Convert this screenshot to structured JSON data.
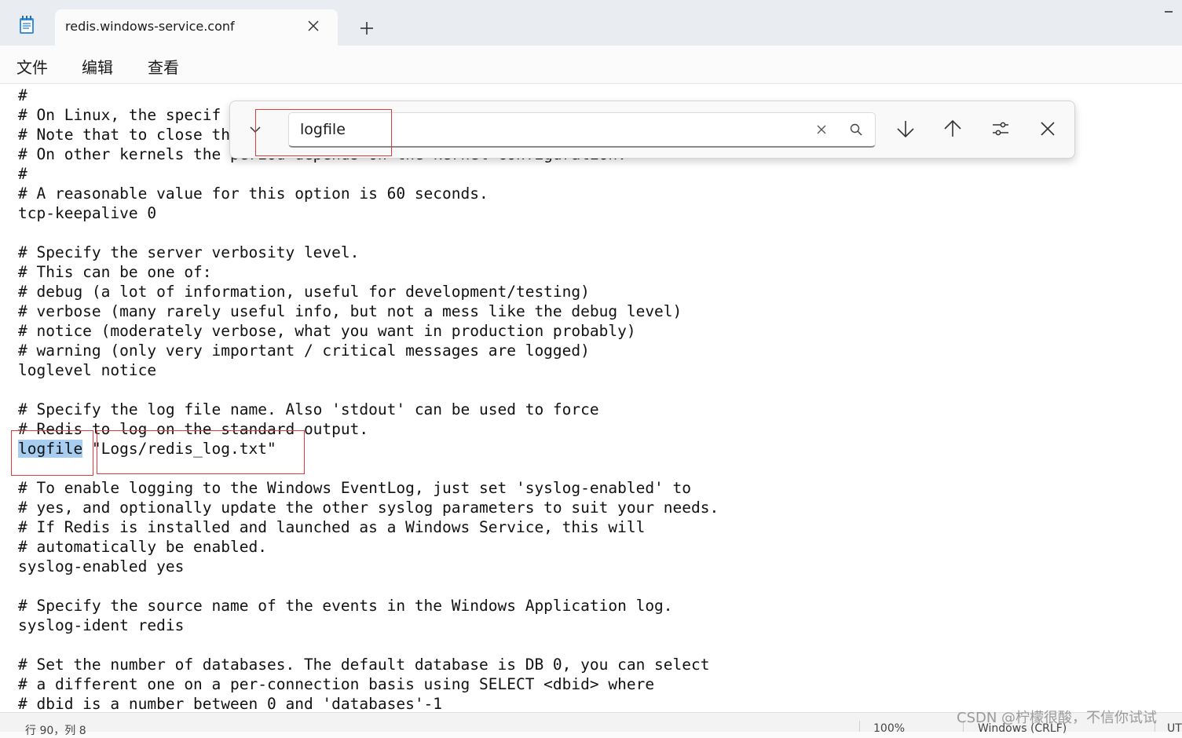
{
  "window": {
    "tab_title": "redis.windows-service.conf",
    "new_tab_label": "+"
  },
  "menu": {
    "items": [
      "文件",
      "编辑",
      "查看"
    ]
  },
  "find": {
    "query": "logfile"
  },
  "editor": {
    "lines": [
      "#",
      "# On Linux, the specif",
      "# Note that to close th",
      "# On other kernels the period depends on the kernel configuration.",
      "#",
      "# A reasonable value for this option is 60 seconds.",
      "tcp-keepalive 0",
      "",
      "# Specify the server verbosity level.",
      "# This can be one of:",
      "# debug (a lot of information, useful for development/testing)",
      "# verbose (many rarely useful info, but not a mess like the debug level)",
      "# notice (moderately verbose, what you want in production probably)",
      "# warning (only very important / critical messages are logged)",
      "loglevel notice",
      "",
      "# Specify the log file name. Also 'stdout' can be used to force",
      "# Redis to log on the standard output.",
      "",
      "",
      "# To enable logging to the Windows EventLog, just set 'syslog-enabled' to",
      "# yes, and optionally update the other syslog parameters to suit your needs.",
      "# If Redis is installed and launched as a Windows Service, this will",
      "# automatically be enabled.",
      "syslog-enabled yes",
      "",
      "# Specify the source name of the events in the Windows Application log.",
      "syslog-ident redis",
      "",
      "# Set the number of databases. The default database is DB 0, you can select",
      "# a different one on a per-connection basis using SELECT <dbid> where",
      "# dbid is a number between 0 and 'databases'-1"
    ],
    "match_line": {
      "keyword": "logfile",
      "rest": " \"Logs/redis_log.txt\""
    }
  },
  "status": {
    "position": "行 90，列 8",
    "zoom": "100%",
    "line_ending": "Windows (CRLF)",
    "encoding": "UT"
  },
  "watermark": "CSDN @柠檬很酸，不信你试试"
}
